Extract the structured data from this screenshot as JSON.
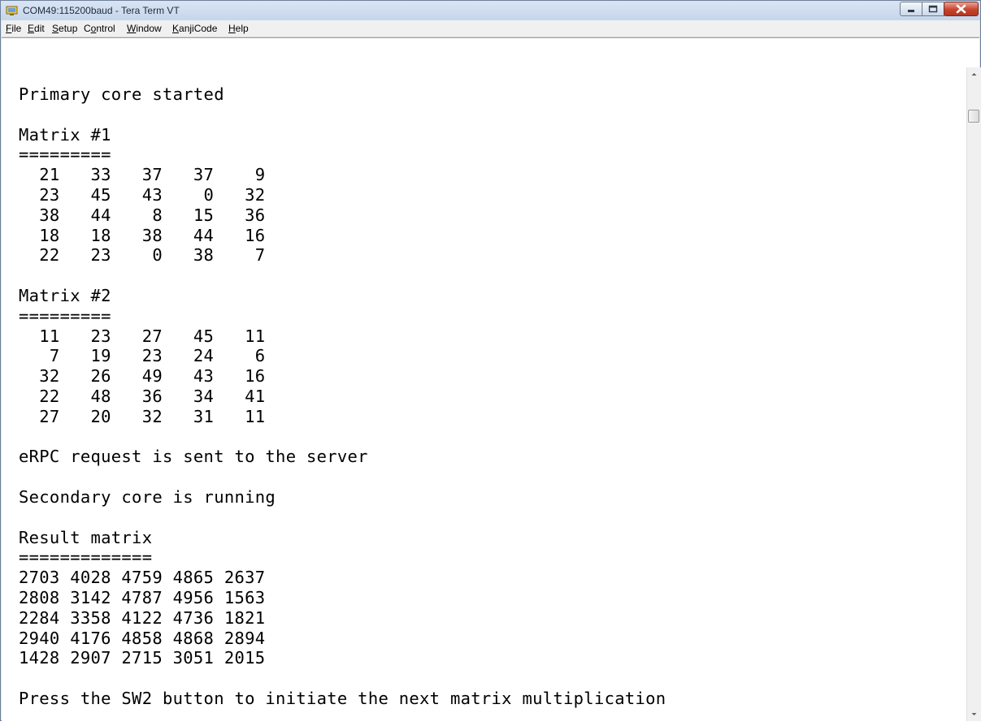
{
  "window": {
    "title": "COM49:115200baud - Tera Term VT"
  },
  "menu": {
    "items": [
      {
        "label": "File",
        "accel": "F",
        "rest": "ile"
      },
      {
        "label": "Edit",
        "accel": "E",
        "rest": "dit"
      },
      {
        "label": "Setup",
        "accel": "S",
        "rest": "etup"
      },
      {
        "label": "Control",
        "accel": "o",
        "pre": "C",
        "rest": "ntrol"
      },
      {
        "label": "Window",
        "accel": "W",
        "rest": "indow"
      },
      {
        "label": "KanjiCode",
        "accel": "K",
        "rest": "anjiCode"
      },
      {
        "label": "Help",
        "accel": "H",
        "rest": "elp"
      }
    ]
  },
  "terminal": {
    "lines": [
      "Primary core started",
      "",
      "Matrix #1",
      "=========",
      "  21   33   37   37    9",
      "  23   45   43    0   32",
      "  38   44    8   15   36",
      "  18   18   38   44   16",
      "  22   23    0   38    7",
      "",
      "Matrix #2",
      "=========",
      "  11   23   27   45   11",
      "   7   19   23   24    6",
      "  32   26   49   43   16",
      "  22   48   36   34   41",
      "  27   20   32   31   11",
      "",
      "eRPC request is sent to the server",
      "",
      "Secondary core is running",
      "",
      "Result matrix",
      "=============",
      "2703 4028 4759 4865 2637",
      "2808 3142 4787 4956 1563",
      "2284 3358 4122 4736 1821",
      "2940 4176 4858 4868 2894",
      "1428 2907 2715 3051 2015",
      "",
      "Press the SW2 button to initiate the next matrix multiplication"
    ]
  },
  "icons": {
    "app": "tera-term-icon",
    "minimize": "minimize-icon",
    "maximize": "maximize-icon",
    "close": "close-icon",
    "scroll_up": "arrow-up-icon",
    "scroll_down": "arrow-down-icon"
  },
  "colors": {
    "close_button": "#c7442e",
    "title_bar": "#c5d6ea",
    "terminal_bg": "#ffffff",
    "terminal_fg": "#000000"
  }
}
